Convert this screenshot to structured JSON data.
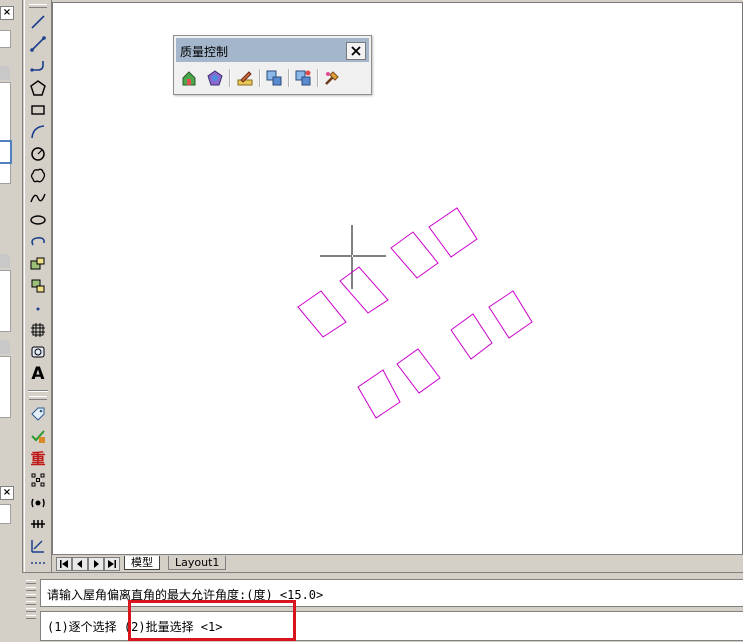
{
  "palette": {
    "title": "质量控制",
    "buttons": [
      "house-check-icon",
      "shape-check-icon",
      "pencil-ruler-icon",
      "select-check-icon",
      "batch-check-icon",
      "paint-fix-icon"
    ]
  },
  "toolbar": {
    "text_tool_label": "A",
    "heavy_tool_label": "重"
  },
  "tabs": {
    "model_label": "模型",
    "layout_label": "Layout1"
  },
  "command": {
    "history_line": "请输入屋角偏离直角的最大允许角度:(度) <15.0>",
    "prompt_line": "(1)逐个选择 (2)批量选择 <1>"
  },
  "colors": {
    "entity_color": "#cc00cc",
    "crosshair_color": "#000000",
    "highlight_color": "#d8141c"
  }
}
